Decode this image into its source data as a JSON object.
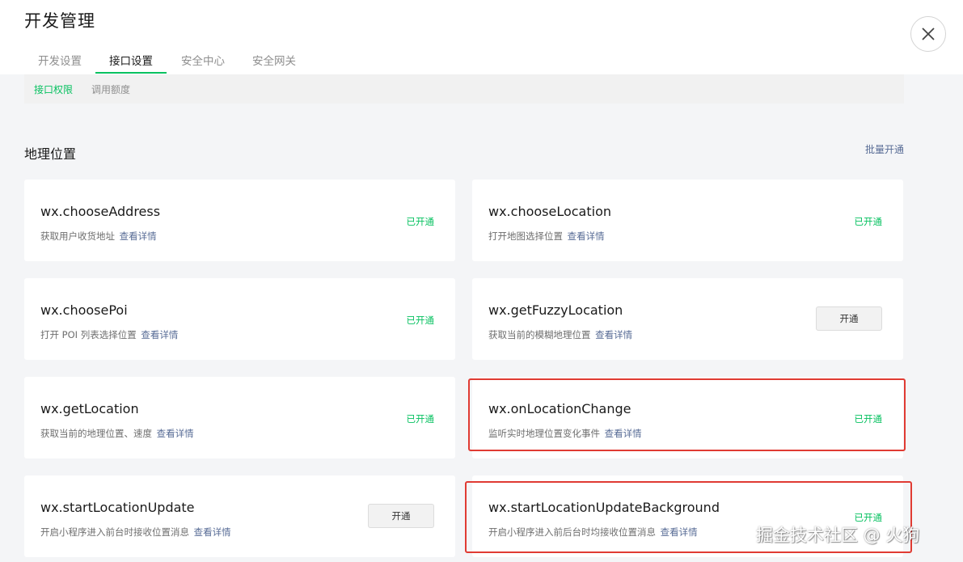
{
  "page": {
    "title": "开发管理",
    "tabs": [
      {
        "label": "开发设置"
      },
      {
        "label": "接口设置",
        "active": true
      },
      {
        "label": "安全中心"
      },
      {
        "label": "安全网关"
      }
    ],
    "subtabs": [
      {
        "label": "接口权限",
        "active": true
      },
      {
        "label": "调用额度"
      }
    ]
  },
  "section": {
    "title": "地理位置",
    "batch_link": "批量开通"
  },
  "apis": [
    {
      "name": "wx.chooseAddress",
      "desc": "获取用户收货地址",
      "link": "查看详情",
      "status": "已开通"
    },
    {
      "name": "wx.chooseLocation",
      "desc": "打开地图选择位置",
      "link": "查看详情",
      "status": "已开通"
    },
    {
      "name": "wx.choosePoi",
      "desc": "打开 POI 列表选择位置",
      "link": "查看详情",
      "status": "已开通"
    },
    {
      "name": "wx.getFuzzyLocation",
      "desc": "获取当前的模糊地理位置",
      "link": "查看详情",
      "button": "开通"
    },
    {
      "name": "wx.getLocation",
      "desc": "获取当前的地理位置、速度",
      "link": "查看详情",
      "status": "已开通"
    },
    {
      "name": "wx.onLocationChange",
      "desc": "监听实时地理位置变化事件",
      "link": "查看详情",
      "status": "已开通",
      "highlighted": true
    },
    {
      "name": "wx.startLocationUpdate",
      "desc": "开启小程序进入前台时接收位置消息",
      "link": "查看详情",
      "button": "开通"
    },
    {
      "name": "wx.startLocationUpdateBackground",
      "desc": "开启小程序进入前后台时均接收位置消息",
      "link": "查看详情",
      "status": "已开通",
      "highlighted": true
    }
  ],
  "watermark": "掘金技术社区 @ 火狗",
  "colors": {
    "accent_green": "#07c160",
    "link_blue": "#576b95",
    "highlight_red": "#e03b33"
  },
  "icons": {
    "close": "close-icon"
  }
}
